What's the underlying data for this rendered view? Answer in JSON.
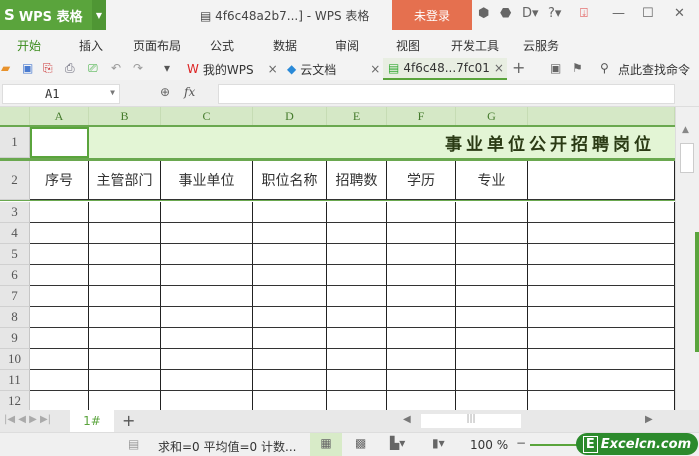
{
  "app": {
    "name": "WPS 表格",
    "logo_glyph": "S",
    "window_title": "4f6c48a2b7...] - WPS 表格",
    "login": "未登录"
  },
  "menu": [
    "开始",
    "插入",
    "页面布局",
    "公式",
    "数据",
    "审阅",
    "视图",
    "开发工具",
    "云服务"
  ],
  "tabs": [
    {
      "label": "我的WPS"
    },
    {
      "label": "云文档"
    },
    {
      "label": "4f6c48...7fc01"
    }
  ],
  "search_cmd": "点此查找命令",
  "formula": {
    "cell": "A1",
    "fx": "fx",
    "value": ""
  },
  "columns": [
    "A",
    "B",
    "C",
    "D",
    "E",
    "F",
    "G"
  ],
  "rows": [
    "1",
    "2",
    "3",
    "4",
    "5",
    "6",
    "7",
    "8",
    "9",
    "10",
    "11",
    "12"
  ],
  "sheet": {
    "title": "事业单位公开招聘岗位",
    "headers": [
      "序号",
      "主管部门",
      "事业单位",
      "职位名称",
      "招聘数",
      "学历",
      "专业"
    ]
  },
  "sheet_tabs": [
    "1#"
  ],
  "status": {
    "text": "求和=0  平均值=0  计数...",
    "zoom": "100 %"
  },
  "watermark": "Excelcn.com",
  "colors": {
    "accent": "#5aa43c",
    "login": "#e5704f",
    "header": "#d5e8c6"
  }
}
